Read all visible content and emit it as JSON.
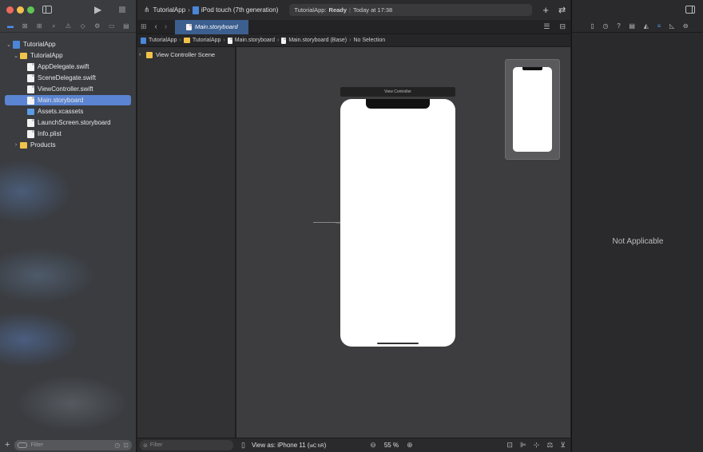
{
  "window": {
    "traffic_colors": [
      "#ed6a5e",
      "#f5bf4f",
      "#61c554"
    ]
  },
  "toolbar": {
    "scheme": "TutorialApp",
    "device": "iPod touch (7th generation)",
    "status_app": "TutorialApp:",
    "status_state": "Ready",
    "status_time": "Today at 17:38"
  },
  "navigator": {
    "items": [
      {
        "label": "TutorialApp",
        "icon": "project-icon"
      },
      {
        "label": "TutorialApp",
        "icon": "folder-icon"
      },
      {
        "label": "AppDelegate.swift",
        "icon": "swift-file-icon"
      },
      {
        "label": "SceneDelegate.swift",
        "icon": "swift-file-icon"
      },
      {
        "label": "ViewController.swift",
        "icon": "swift-file-icon"
      },
      {
        "label": "Main.storyboard",
        "icon": "storyboard-file-icon"
      },
      {
        "label": "Assets.xcassets",
        "icon": "assets-icon"
      },
      {
        "label": "LaunchScreen.storyboard",
        "icon": "storyboard-file-icon"
      },
      {
        "label": "Info.plist",
        "icon": "plist-icon"
      },
      {
        "label": "Products",
        "icon": "folder-icon"
      }
    ],
    "filter_placeholder": "Filter"
  },
  "editor": {
    "tab": "Main.storyboard",
    "breadcrumb": [
      "TutorialApp",
      "TutorialApp",
      "Main.storyboard",
      "Main.storyboard (Base)",
      "No Selection"
    ],
    "outline_item": "View Controller Scene",
    "outline_filter_placeholder": "Filter",
    "scene_title": "View Controller",
    "view_as": "View as: iPhone 11 (",
    "view_as_keys": "wC hR",
    "view_as_close": ")",
    "zoom": "55 %"
  },
  "inspector": {
    "empty_text": "Not Applicable"
  },
  "colors": {
    "selection": "#5b84d2",
    "folder": "#f0c24a"
  }
}
